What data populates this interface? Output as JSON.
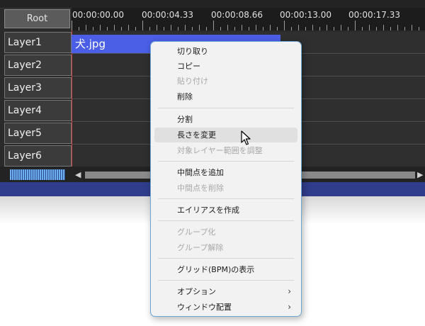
{
  "root_button": "Root",
  "ruler": {
    "times": [
      "00:00:00.00",
      "00:00:04.33",
      "00:00:08.66",
      "00:00:13.00",
      "00:00:17.33"
    ]
  },
  "layers": [
    "Layer1",
    "Layer2",
    "Layer3",
    "Layer4",
    "Layer5",
    "Layer6"
  ],
  "clip": {
    "label": "犬.jpg"
  },
  "colors": {
    "clip": "#4a5fe6",
    "menu_border": "#6ea6d8",
    "status_bar": "#2f3d8c"
  },
  "context_menu": {
    "items": [
      {
        "label": "切り取り",
        "disabled": false
      },
      {
        "label": "コピー",
        "disabled": false
      },
      {
        "label": "貼り付け",
        "disabled": true
      },
      {
        "label": "削除",
        "disabled": false
      },
      {
        "label": "分割",
        "disabled": false
      },
      {
        "label": "長さを変更",
        "disabled": false,
        "hovered": true
      },
      {
        "label": "対象レイヤー範囲を調整",
        "disabled": true
      },
      {
        "label": "中間点を追加",
        "disabled": false
      },
      {
        "label": "中間点を削除",
        "disabled": true
      },
      {
        "label": "エイリアスを作成",
        "disabled": false
      },
      {
        "label": "グループ化",
        "disabled": true
      },
      {
        "label": "グループ解除",
        "disabled": true
      },
      {
        "label": "グリッド(BPM)の表示",
        "disabled": false
      },
      {
        "label": "オプション",
        "disabled": false,
        "submenu": true
      },
      {
        "label": "ウィンドウ配置",
        "disabled": false,
        "submenu": true
      }
    ]
  }
}
